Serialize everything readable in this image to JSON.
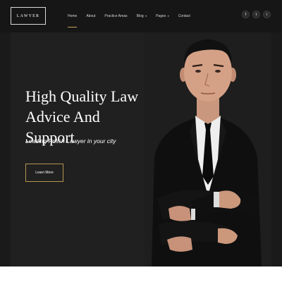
{
  "brand": {
    "logo_text": "LAWYER"
  },
  "nav": {
    "items": [
      {
        "label": "Home",
        "active": true,
        "dropdown": false
      },
      {
        "label": "About",
        "active": false,
        "dropdown": false
      },
      {
        "label": "Practice Areas",
        "active": false,
        "dropdown": false
      },
      {
        "label": "Blog",
        "active": false,
        "dropdown": true
      },
      {
        "label": "Pages",
        "active": false,
        "dropdown": true
      },
      {
        "label": "Contact",
        "active": false,
        "dropdown": false
      }
    ],
    "dropdown_glyph": "▾"
  },
  "social": [
    {
      "icon": "facebook-icon",
      "glyph": "f"
    },
    {
      "icon": "twitter-icon",
      "glyph": "t"
    },
    {
      "icon": "instagram-icon",
      "glyph": "i"
    }
  ],
  "hero": {
    "title_line1": "High Quality Law",
    "title_line2": "Advice And Support",
    "subtitle": "Leading Polish Lawyer in your city",
    "cta_label": "Learn More"
  },
  "colors": {
    "accent": "#c6a35d",
    "background": "#1a1a1a",
    "hero_background": "#202020"
  }
}
